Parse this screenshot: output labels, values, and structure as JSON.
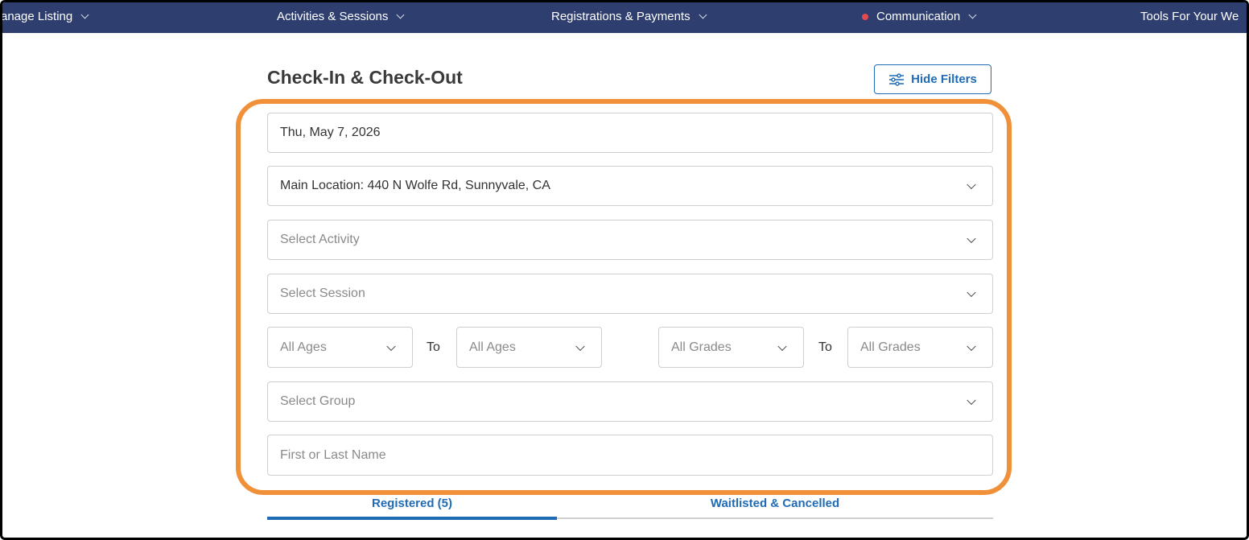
{
  "nav": {
    "items": [
      {
        "label": "anage Listing"
      },
      {
        "label": "Activities & Sessions"
      },
      {
        "label": "Registrations & Payments"
      },
      {
        "label": "Communication"
      },
      {
        "label": "Tools For Your We"
      }
    ],
    "notification_color": "#e5484d",
    "background_color": "#2e3e6e"
  },
  "page": {
    "title": "Check-In & Check-Out",
    "hide_filters_label": "Hide Filters",
    "accent_color": "#1f6bb5",
    "highlight_color": "#f0913a"
  },
  "filters": {
    "date": "Thu, May 7, 2026",
    "location": "Main Location: 440 N Wolfe Rd, Sunnyvale, CA",
    "activity_placeholder": "Select Activity",
    "session_placeholder": "Select Session",
    "age_from": "All Ages",
    "age_to_label": "To",
    "age_to": "All Ages",
    "grade_from": "All Grades",
    "grade_to_label": "To",
    "grade_to": "All Grades",
    "group_placeholder": "Select Group",
    "name_placeholder": "First or Last Name"
  },
  "tabs": [
    {
      "label": "Registered (5)",
      "active": true
    },
    {
      "label": "Waitlisted & Cancelled",
      "active": false
    }
  ]
}
